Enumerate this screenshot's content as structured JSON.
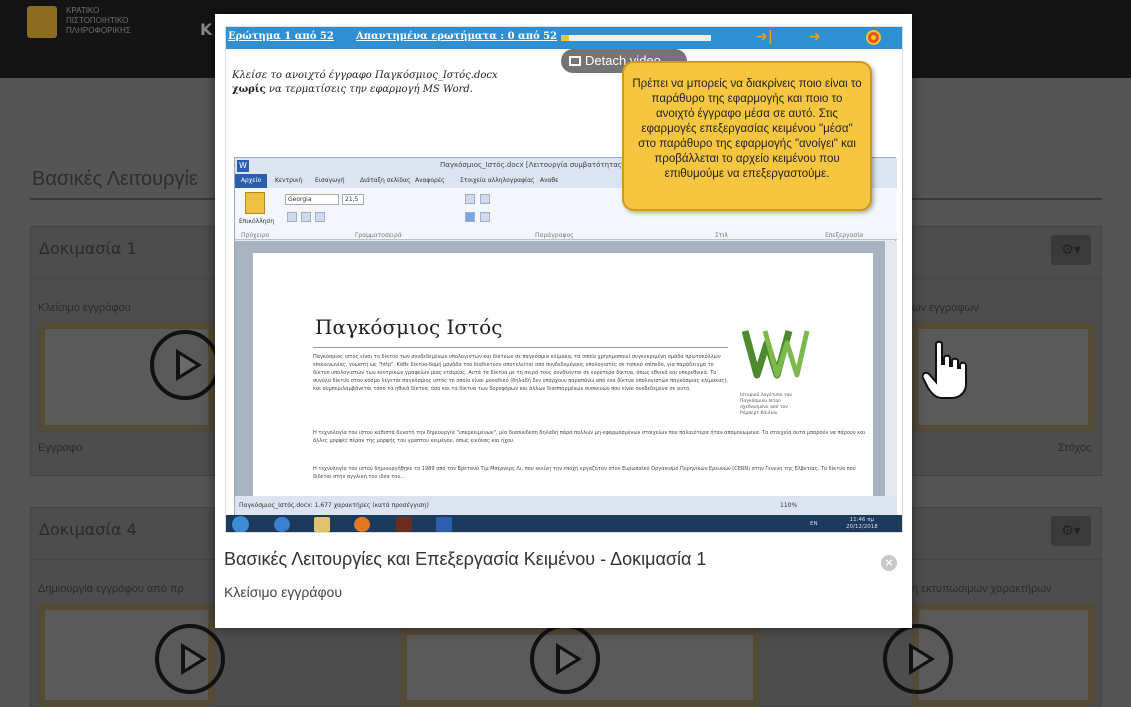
{
  "background": {
    "logo_lines": [
      "ΚΡΑΤΙΚΟ",
      "ΠΙΣΤΟΠΟΙΗΤΙΚΟ",
      "ΠΛΗΡΟΦΟΡΙΚΗΣ"
    ],
    "header_fragment": "Κ",
    "page_title": "Βασικές Λειτουργίε",
    "panel1": {
      "title": "Δοκιμασία 1",
      "gear": "⚙▾",
      "card_left_label": "Κλείσιμο εγγράφου",
      "card_right_label": "ων εγγραφων",
      "bottom_left_label": "Εγγραφο",
      "bottom_right_label": "Στόχος"
    },
    "panel4": {
      "title": "Δοκιμασία 4",
      "gear": "⚙▾",
      "card_left_label": "Δημιουργία εγγράφου από πρ",
      "card_right_label": "η εκτυπώσιμων χαρακτήρων"
    }
  },
  "modal": {
    "title": "Βασικές Λειτουργίες και Επεξεργασία Κειμένου - Δοκιμασία 1",
    "subtitle": "Κλείσιμο εγγράφου",
    "close_glyph": "×"
  },
  "video": {
    "quiz": {
      "question_label": "Ερώτημα 1 από 52",
      "answered_label": "Απαντημένα ερωτήματα : 0 από 52",
      "progress": 0.05
    },
    "detach_label": "Detach video",
    "instruction_prefix": "Κλείσε το ανοιχτό έγγραφο",
    "instruction_doc": "Παγκόσμιος_Ιστός.docx",
    "instruction_bold": "χωρίς",
    "instruction_suffix": "να τερματίσεις την εφαρμογή MS Word.",
    "tooltip": "Πρέπει να μπορείς να διακρίνεις ποιο είναι το παράθυρο της εφαρμογής και ποιο το ανοιχτό έγγραφο μέσα σε αυτό. Στις εφαρμογές επεξεργασίας κειμένου \"μέσα\" στο παράθυρο της εφαρμογής \"ανοίγει\" και προβάλλεται το αρχείο κειμένου που επιθυμούμε να επεξεργαστούμε.",
    "word": {
      "title": "Παγκόσμιος_Ιστός.docx [Λειτουργία συμβατότητας] -",
      "tabs": [
        "Αρχείο",
        "Κεντρική",
        "Εισαγωγή",
        "Διάταξη σελίδας",
        "Αναφορές",
        "Στοιχεία αλληλογραφίας",
        "Αναθε"
      ],
      "font": "Georgia",
      "size": "21,5",
      "groups": [
        "Πρόχειρο",
        "Γραμματοσειρά",
        "Παράγραφος",
        "Στιλ",
        "Επεξεργασία"
      ],
      "paste_label": "Επικόλληση",
      "doc_heading": "Παγκόσμιος Ιστός",
      "doc_para1": "Παγκόσμιος ιστός είναι το δίκτυο των συνδεδεμένων υπολογιστών και δικτύων σε παγκόσμια κλίμακα, τα οποία χρησιμοποιεί συγκεκριμένη ομάδα πρωτοκόλλων επικοινωνίας, γνωστή ως \"http\". Κάθε δίκτυο-δομή μονάδα του διαδικτύου αποτελείται από συνδεδεμένους υπολογιστές σε τοπικό επίπεδο, για παράδειγμα το δίκτυο υπολογιστών των κεντρικών γραφείων μιας εταιρίας. Αυτά τα δίκτυα με τη σειρά τους συνδέονται σε ευρύτερα δίκτυα, όπως εθνικά και υπερεθνικά. Το συνόλο δίκτυο στον κόσμο λέγεται παγκόσμιος ιστός το οποίο είναι μοναδικό (δηλαδή δεν υπάρχουν παραπάνω από ένα δίκτυα υπολογιστών παγκόσμιας κλίμακας), και συμπεριλαμβάνεται τόσο τα ηθικά δίκτυα, όσο και τα δίκτυα των δορυφόρων και άλλων διασπαρμένων συσκευών που είναι συνδεδεμένα σε αυτό.",
      "doc_para2": "Η τεχνολογία του ιστού καθιστά δυνατή την δημιουργία \"υπερκειμένων\", μία διασύνδεση δηλαδή πάρα πολλών μη-εφαρμοσμένων στοιχείων που παλαιότερα ήταν απομονωμένα. Τα στοιχεία αυτά μπορούν να πάρουν και άλλες μορφές πέραν της μορφής του γραπτού κειμένου, όπως εικόνας και ήχου.",
      "doc_para3": "Η τεχνολογία του ιστού δημιουργήθηκε το 1989 από τον Βρετανό Τιμ Μπέρνερς Λι, που εκείνη την εποχή εργαζόταν στον Ευρωπαϊκό Οργανισμό Πυρηνικών Ερευνών (CERN) στην Γενεύη της Ελβετίας. Το δίκτυο που δίδεται στην αγγλική του ιδέα του...",
      "logo_caption": "Ιστορικό λογότυπο του Παγκόσμιου Ιστού σχεδιασμένο από τον Ρόμπερτ Κάιλιου",
      "status_left": "Παγκόσμιος_Ιστός.docx: 1.677 χαρακτήρες (κατά προσέγγιση)",
      "zoom": "110%"
    },
    "taskbar": {
      "lang": "EN",
      "time": "11:46 πμ",
      "date": "20/12/2018"
    }
  },
  "colors": {
    "quiz_bar": "#2f8fd3",
    "tooltip_bg": "#f7c640",
    "accent_orange": "#f89a1c",
    "word_blue": "#2b5fae"
  },
  "icons": {
    "skip": "skip-icon",
    "next": "next-arrow-icon",
    "stop": "stop-icon",
    "detach": "detach-window-icon",
    "cursor": "hand-pointer-icon"
  }
}
